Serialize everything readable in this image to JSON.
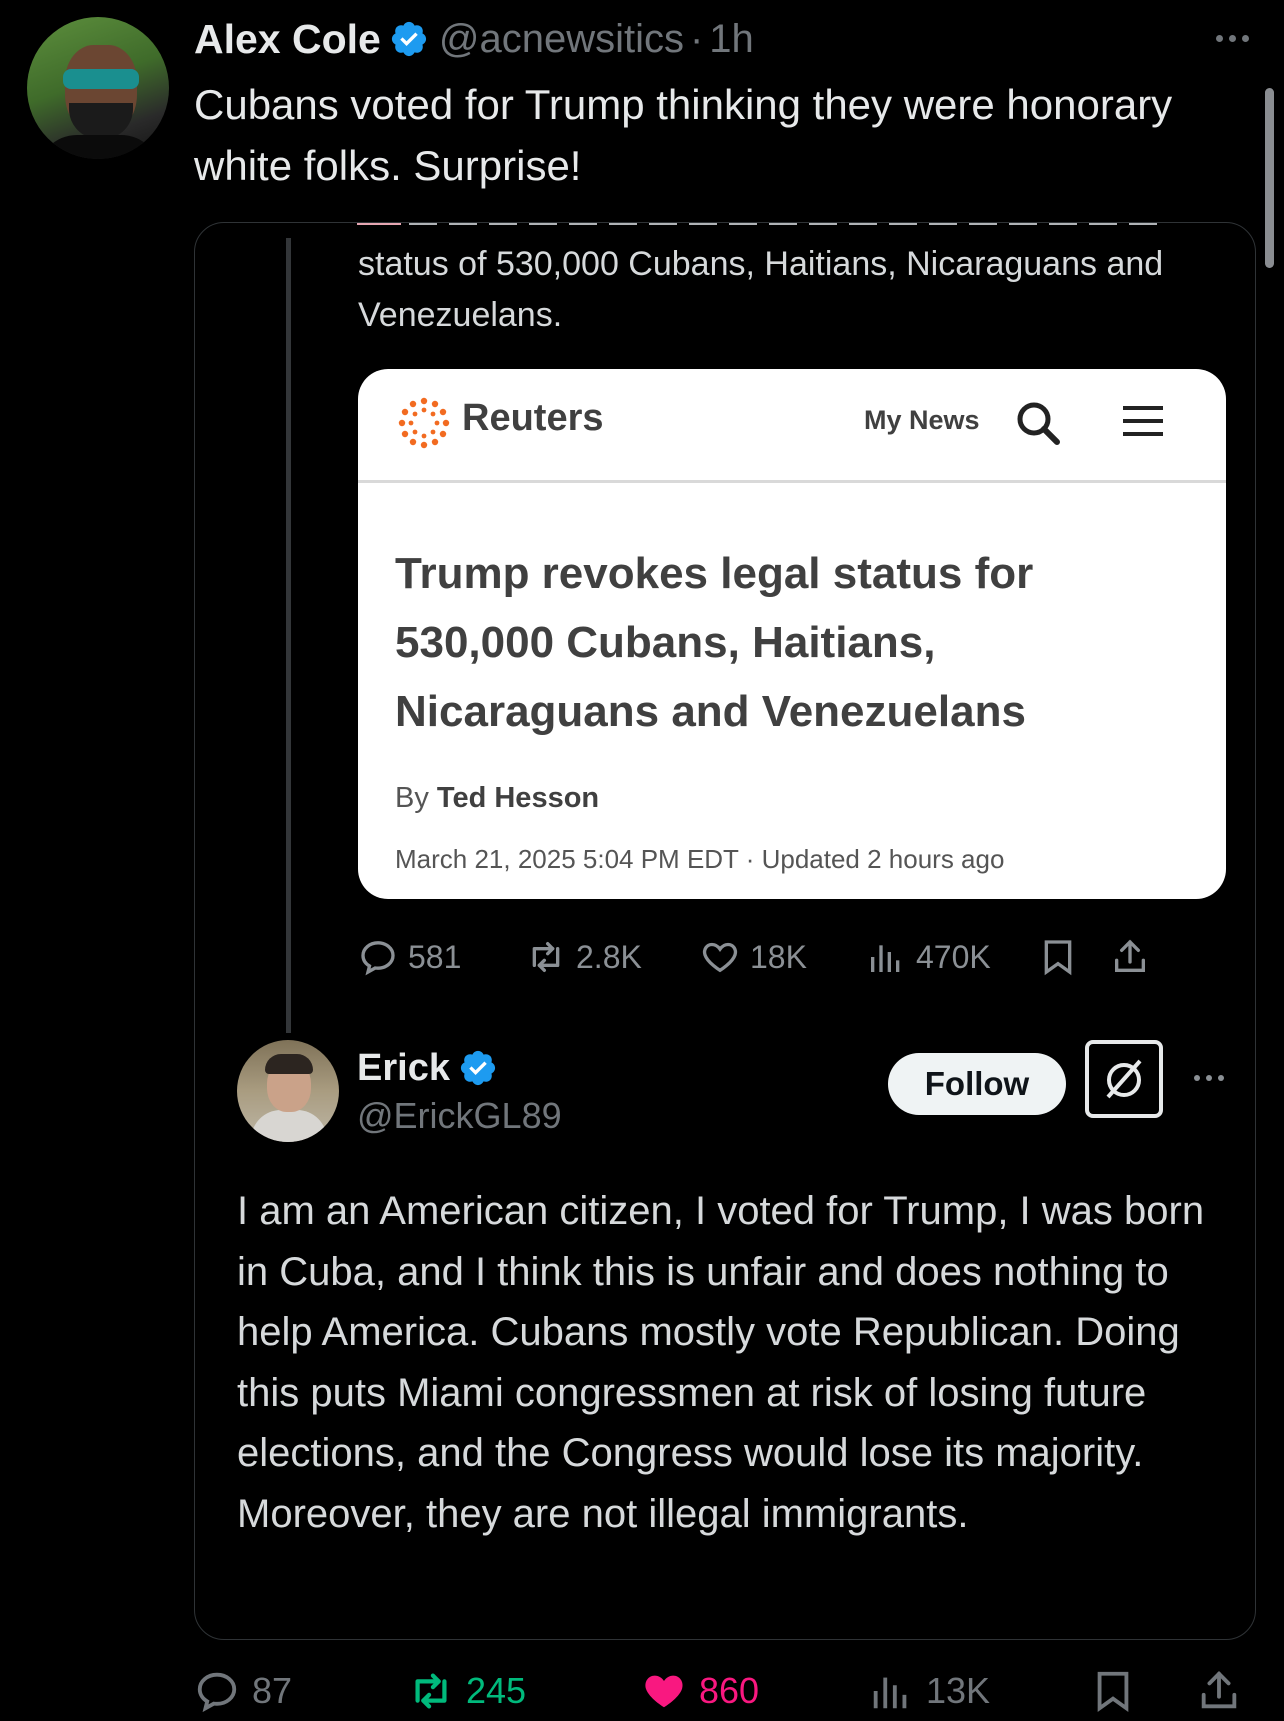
{
  "tweet": {
    "author_name": "Alex Cole",
    "author_handle": "@acnewsitics",
    "separator": "·",
    "time": "1h",
    "text": "Cubans voted for Trump thinking they were honorary white folks. Surprise!",
    "stats": {
      "replies": "87",
      "reposts": "245",
      "likes": "860",
      "views": "13K"
    },
    "colors": {
      "verified": "#1d9bf0",
      "repost_active": "#00ba7c",
      "like_active": "#f91880"
    }
  },
  "quote": {
    "inner_text": "status of 530,000 Cubans, Haitians, Nicaraguans and Venezuelans.",
    "article": {
      "site": "Reuters",
      "nav_label": "My News",
      "headline": "Trump revokes legal status for 530,000 Cubans, Haitians, Nicaraguans and Venezuelans",
      "byline_prefix": "By",
      "author": "Ted Hesson",
      "dateline": "March 21, 2025 5:04 PM EDT · Updated 2 hours ago"
    },
    "inner_stats": {
      "replies": "581",
      "reposts": "2.8K",
      "likes": "18K",
      "views": "470K"
    },
    "reply": {
      "name": "Erick",
      "handle": "@ErickGL89",
      "follow_label": "Follow",
      "text": "I am an American citizen, I voted for Trump, I was born in Cuba, and I think this is unfair and does nothing to help America. Cubans mostly vote Republican. Doing this puts Miami congressmen at risk of losing future elections, and the Congress would lose its majority. Moreover, they are not illegal immigrants."
    }
  }
}
